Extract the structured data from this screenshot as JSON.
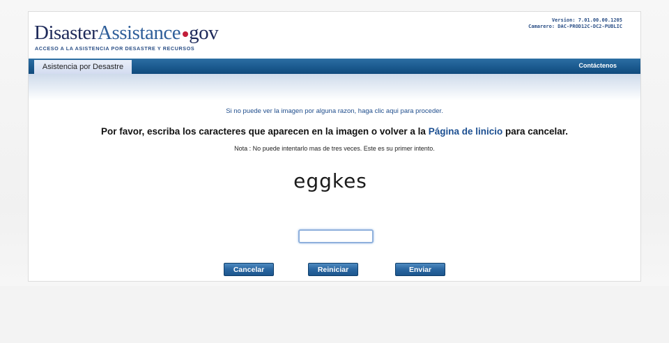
{
  "header": {
    "logo": {
      "word1": "Disaster",
      "word2": "Assistance",
      "word3": "gov"
    },
    "tagline": "ACCESO A LA ASISTENCIA POR DESASTRE Y RECURSOS",
    "version_line": "Version: 7.01.00.00.1205",
    "server_line": "Camarero: DAC-PROD12C-DC2-PUBLIC"
  },
  "nav": {
    "active_tab": "Asistencia por Desastre",
    "contact_link": "Contáctenos"
  },
  "captcha_page": {
    "proceed_link": "Si no puede ver la imagen por alguna razon, haga clic aqui para proceder.",
    "instruction_before": "Por favor, escriba los caracteres que aparecen en la imagen o volver a la ",
    "instruction_link": "Página de linicio",
    "instruction_after": " para cancelar.",
    "note": "Nota : No puede intentarlo mas de tres veces. Este es su primer intento.",
    "captcha_text": "eggkes",
    "answer_value": "",
    "buttons": {
      "cancel": "Cancelar",
      "reset": "Reiniciar",
      "submit": "Enviar"
    }
  },
  "colors": {
    "nav_blue": "#1b5a8f",
    "link_blue": "#1c4f91",
    "logo_dot_red": "#c21e3a",
    "button_blue": "#2966a0"
  }
}
